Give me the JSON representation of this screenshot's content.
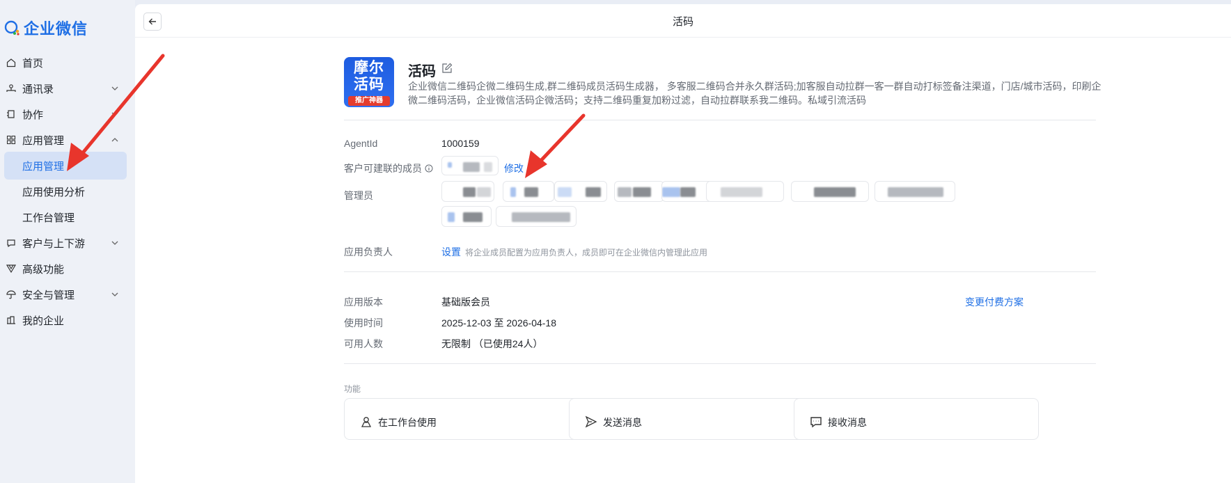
{
  "brand": {
    "name": "企业微信"
  },
  "sidebar": {
    "items": [
      {
        "label": "首页",
        "icon": "home-icon"
      },
      {
        "label": "通讯录",
        "icon": "contacts-icon"
      },
      {
        "label": "协作",
        "icon": "collab-icon"
      },
      {
        "label": "应用管理",
        "icon": "apps-icon"
      },
      {
        "label": "应用管理"
      },
      {
        "label": "应用使用分析"
      },
      {
        "label": "工作台管理"
      },
      {
        "label": "客户与上下游",
        "icon": "chat-icon"
      },
      {
        "label": "高级功能",
        "icon": "advanced-icon"
      },
      {
        "label": "安全与管理",
        "icon": "umbrella-icon"
      },
      {
        "label": "我的企业",
        "icon": "company-icon"
      }
    ]
  },
  "header": {
    "title": "活码"
  },
  "app": {
    "icon_line1": "摩尔",
    "icon_line2": "活码",
    "icon_tag": "推广神器",
    "name": "活码",
    "description": "企业微信二维码企微二维码生成,群二维码成员活码生成器， 多客服二维码合并永久群活码;加客服自动拉群一客一群自动打标签备注渠道，门店/城市活码，印刷企微二维码活码，企业微信活码企微活码；支持二维码重复加粉过滤，自动拉群联系我二维码。私域引流活码"
  },
  "details": {
    "agentid_label": "AgentId",
    "agentid_value": "1000159",
    "members_label": "客户可建联的成员",
    "members_action": "修改",
    "admins_label": "管理员",
    "owner_label": "应用负责人",
    "owner_action": "设置",
    "owner_hint": "将企业成员配置为应用负责人，成员即可在企业微信内管理此应用"
  },
  "plan": {
    "version_label": "应用版本",
    "version_value": "基础版会员",
    "change_plan": "变更付费方案",
    "period_label": "使用时间",
    "period_value": "2025-12-03 至 2026-04-18",
    "users_label": "可用人数",
    "users_value": "无限制 （已使用24人）"
  },
  "features": {
    "label": "功能",
    "cards": [
      {
        "label": "在工作台使用",
        "icon": "workbench-icon"
      },
      {
        "label": "发送消息",
        "icon": "send-icon"
      },
      {
        "label": "接收消息",
        "icon": "message-icon"
      }
    ]
  },
  "colors": {
    "accent": "#1f6fe5",
    "annotation": "#e8352c"
  }
}
